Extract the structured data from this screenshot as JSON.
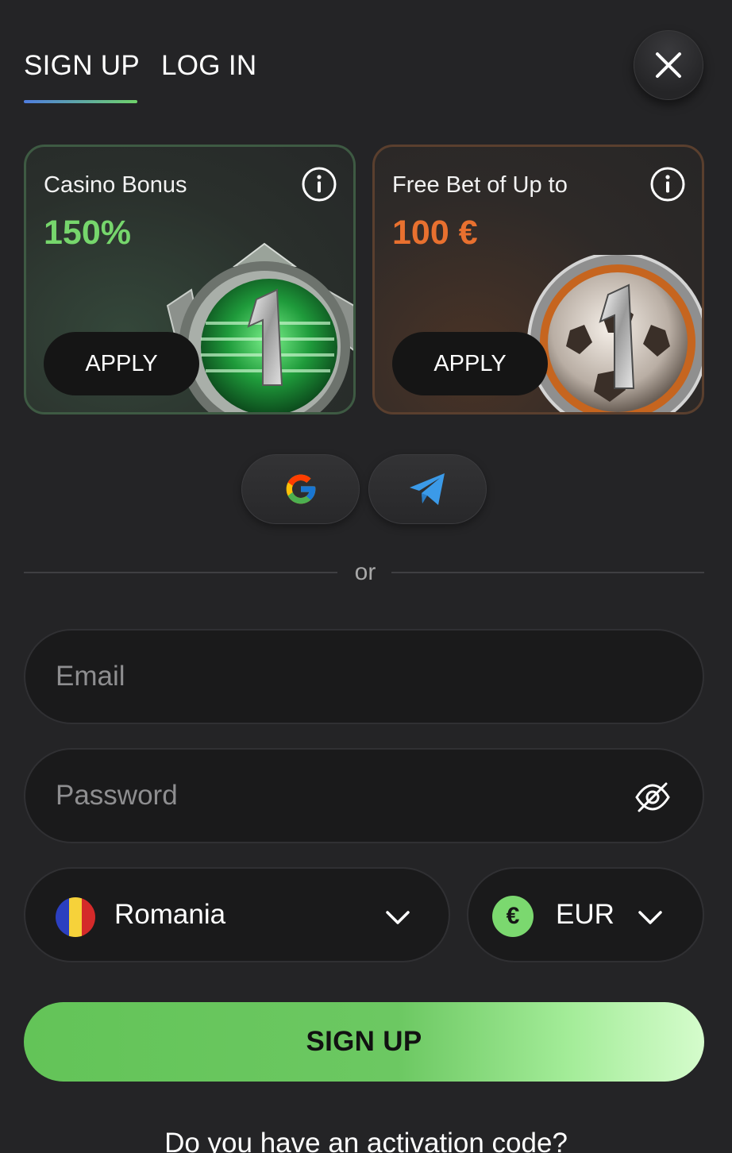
{
  "tabs": {
    "signup": "SIGN UP",
    "login": "LOG IN",
    "active": "signup"
  },
  "bonuses": [
    {
      "title": "Casino Bonus",
      "amount": "150%",
      "apply": "APPLY",
      "accent": "#76d66c"
    },
    {
      "title": "Free Bet of Up to",
      "amount": "100 €",
      "apply": "APPLY",
      "accent": "#e8702f"
    }
  ],
  "divider": {
    "text": "or"
  },
  "form": {
    "email_placeholder": "Email",
    "password_placeholder": "Password",
    "country": "Romania",
    "currency": "EUR",
    "currency_symbol": "€",
    "submit": "SIGN UP"
  },
  "activation_text": "Do you have an activation code?",
  "colors": {
    "background": "#242426",
    "accent_green": "#76d66c",
    "accent_orange": "#e8702f"
  }
}
